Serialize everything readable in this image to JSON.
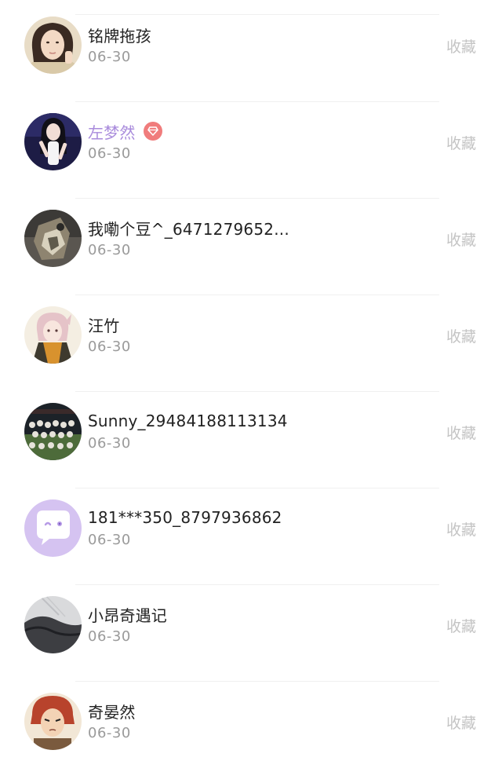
{
  "items": [
    {
      "name": "铭牌拖孩",
      "date": "06-30",
      "action": "收藏",
      "vip": false,
      "avatar": "avatar-girl-portrait"
    },
    {
      "name": "左梦然",
      "date": "06-30",
      "action": "收藏",
      "vip": true,
      "avatar": "avatar-girl-dark"
    },
    {
      "name": "我嘞个豆^_6471279652...",
      "date": "06-30",
      "action": "收藏",
      "vip": false,
      "avatar": "avatar-figure-dark"
    },
    {
      "name": "汪竹",
      "date": "06-30",
      "action": "收藏",
      "vip": false,
      "avatar": "avatar-anime-character"
    },
    {
      "name": "Sunny_29484188113134",
      "date": "06-30",
      "action": "收藏",
      "vip": false,
      "avatar": "avatar-group-photo"
    },
    {
      "name": "181***350_8797936862",
      "date": "06-30",
      "action": "收藏",
      "vip": false,
      "avatar": "avatar-default-chat"
    },
    {
      "name": "小昂奇遇记",
      "date": "06-30",
      "action": "收藏",
      "vip": false,
      "avatar": "avatar-hair-closeup"
    },
    {
      "name": "奇晏然",
      "date": "06-30",
      "action": "收藏",
      "vip": false,
      "avatar": "avatar-anime-red-hair"
    }
  ],
  "colors": {
    "name": "#222222",
    "vip_name": "#a98bdc",
    "date": "#9a9a9a",
    "action": "#c4c4c4",
    "vip_badge": "#f07c7c",
    "divider": "#f0f0f0"
  }
}
